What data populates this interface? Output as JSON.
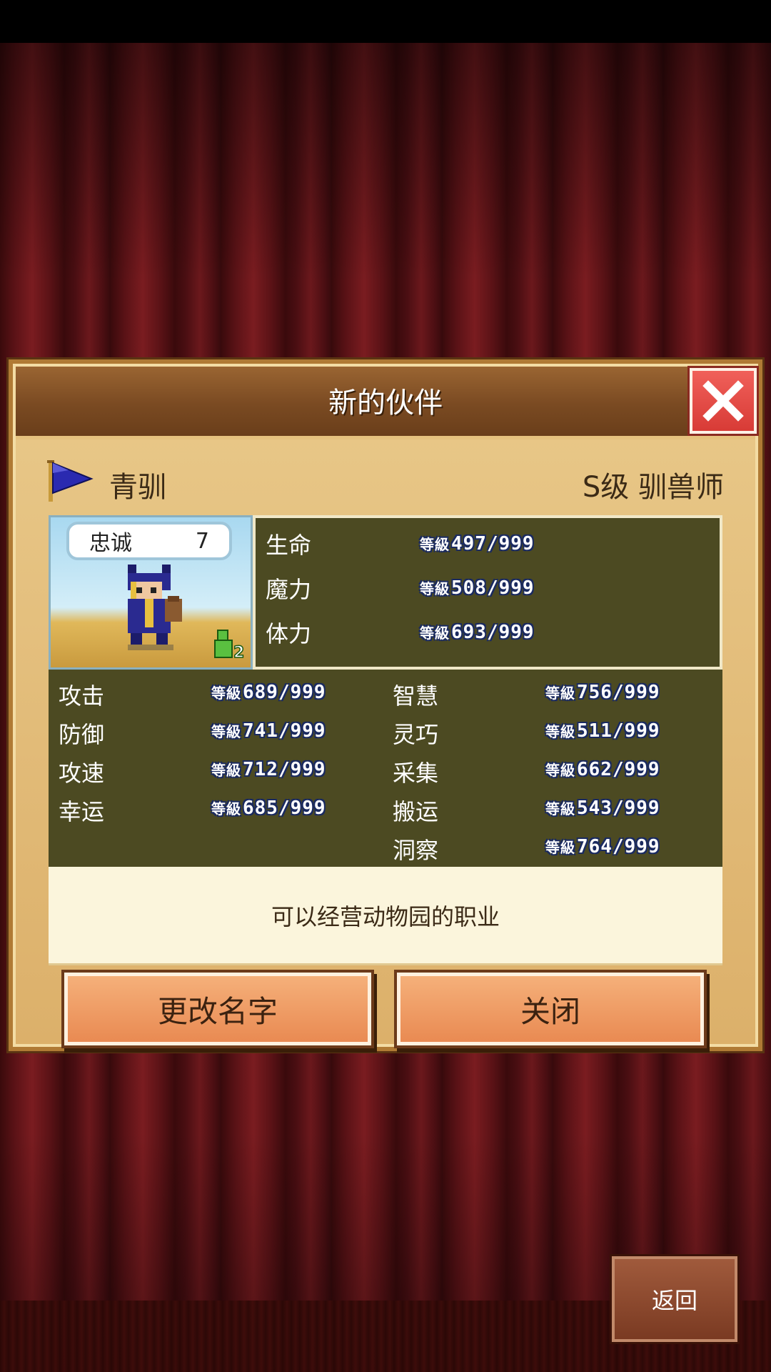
{
  "dialog": {
    "title": "新的伙伴",
    "character_name": "青驯",
    "character_class": "S级 驯兽师",
    "loyalty_label": "忠诚",
    "loyalty_value": "7",
    "party_badge": "2",
    "description": "可以经营动物园的职业"
  },
  "main_stats": [
    {
      "label": "生命",
      "level_prefix": "等級",
      "value": "497/999"
    },
    {
      "label": "魔力",
      "level_prefix": "等級",
      "value": "508/999"
    },
    {
      "label": "体力",
      "level_prefix": "等級",
      "value": "693/999"
    }
  ],
  "sub_stats_left": [
    {
      "label": "攻击",
      "level_prefix": "等級",
      "value": "689/999"
    },
    {
      "label": "防御",
      "level_prefix": "等級",
      "value": "741/999"
    },
    {
      "label": "攻速",
      "level_prefix": "等級",
      "value": "712/999"
    },
    {
      "label": "幸运",
      "level_prefix": "等級",
      "value": "685/999"
    }
  ],
  "sub_stats_right": [
    {
      "label": "智慧",
      "level_prefix": "等級",
      "value": "756/999"
    },
    {
      "label": "灵巧",
      "level_prefix": "等級",
      "value": "511/999"
    },
    {
      "label": "采集",
      "level_prefix": "等級",
      "value": "662/999"
    },
    {
      "label": "搬运",
      "level_prefix": "等級",
      "value": "543/999"
    },
    {
      "label": "洞察",
      "level_prefix": "等級",
      "value": "764/999"
    }
  ],
  "buttons": {
    "rename": "更改名字",
    "close": "关闭",
    "back": "返回"
  },
  "colors": {
    "stat_panel": "#4c4a22",
    "button_orange": "#e98a52",
    "close_red": "#d83b36",
    "flag_blue": "#2a2ab0"
  },
  "icons": {
    "flag": "flag-icon",
    "close": "close-icon",
    "party": "party-member-icon"
  }
}
